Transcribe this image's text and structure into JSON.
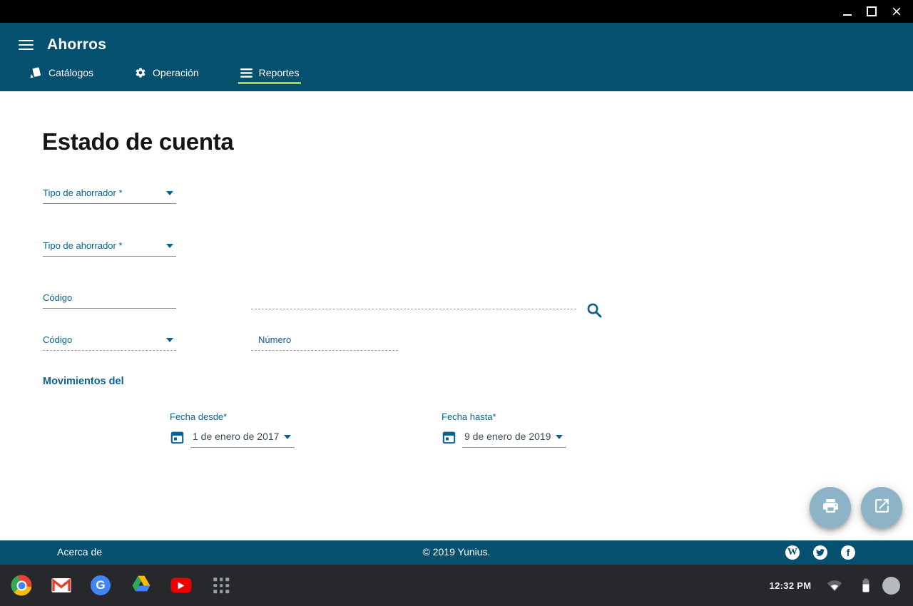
{
  "window_controls": {
    "buttons": [
      "minimize",
      "maximize",
      "close"
    ]
  },
  "app_bar": {
    "title": "Ahorros",
    "tabs": [
      {
        "label": "Catálogos",
        "icon": "catalog-icon",
        "active": false
      },
      {
        "label": "Operación",
        "icon": "gear-icon",
        "active": false
      },
      {
        "label": "Reportes",
        "icon": "reorder-icon",
        "active": true
      }
    ]
  },
  "page": {
    "title": "Estado de cuenta",
    "section_title": "Movimientos del"
  },
  "fields": {
    "saver_type_a": {
      "label": "Tipo de ahorrador *",
      "type": "select",
      "enabled": true
    },
    "saver_type_b": {
      "label": "Tipo de ahorrador *",
      "type": "select",
      "enabled": true
    },
    "code_text": {
      "label": "Código",
      "type": "text",
      "enabled": true
    },
    "search": {
      "value": "",
      "icon": "search-icon",
      "enabled": false
    },
    "code_select": {
      "label": "Código",
      "type": "select",
      "enabled": false
    },
    "number": {
      "label": "Número",
      "type": "text",
      "enabled": false
    }
  },
  "dates": {
    "from": {
      "label": "Fecha desde*",
      "value": "1 de enero de 2017",
      "icon": "calendar-icon"
    },
    "to": {
      "label": "Fecha hasta*",
      "value": "9 de enero de 2019",
      "icon": "calendar-icon"
    }
  },
  "fabs": [
    {
      "icon": "print-icon"
    },
    {
      "icon": "open-in-new-icon"
    }
  ],
  "footer": {
    "about": "Acerca de",
    "copyright": "© 2019 Yunius.",
    "social": [
      "wordpress-icon",
      "twitter-icon",
      "facebook-icon"
    ],
    "wordpress_glyph": "W",
    "facebook_glyph": "f"
  },
  "shelf": {
    "apps": [
      "chrome-icon",
      "gmail-icon",
      "google-icon",
      "drive-icon",
      "youtube-icon",
      "apps-grid-icon"
    ],
    "google_glyph": "G",
    "clock": "12:32 PM",
    "status": [
      "wifi-icon",
      "battery-icon",
      "avatar"
    ]
  },
  "colors": {
    "title_bar": "#000000",
    "app_bar": "#05506f",
    "footer": "#05506f",
    "tab_active_underline": "#a8d133",
    "field_label": "#0b6190",
    "fab": "#8db3c7",
    "shelf": "#26282b"
  }
}
